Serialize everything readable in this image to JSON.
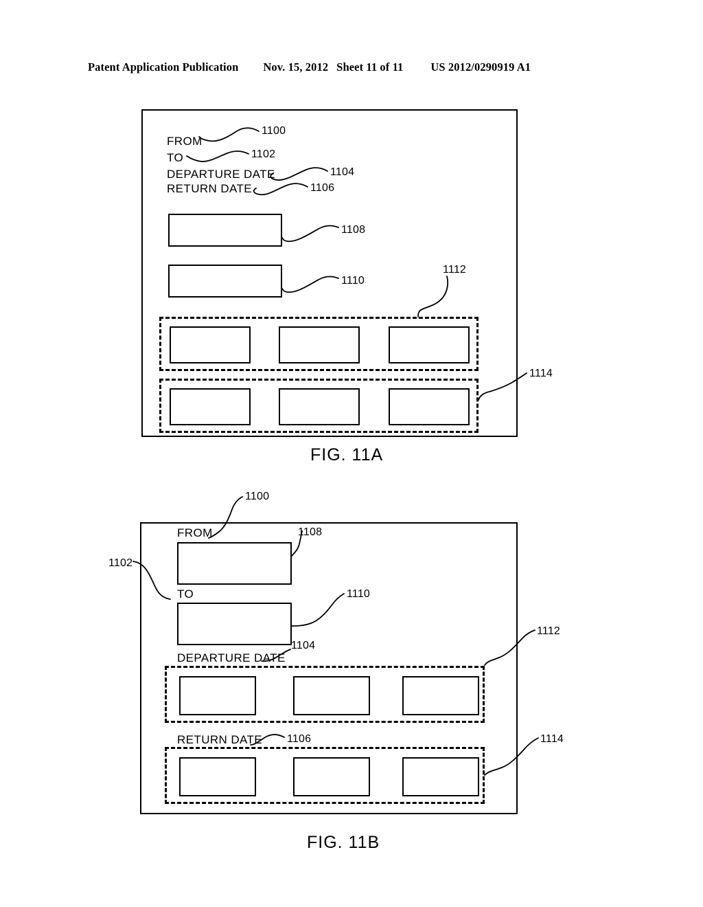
{
  "header": {
    "publication": "Patent Application Publication",
    "date": "Nov. 15, 2012",
    "sheet": "Sheet 11 of 11",
    "doc_number": "US 2012/0290919 A1"
  },
  "colors": {
    "ink": "#000000",
    "paper": "#ffffff"
  },
  "figures": [
    {
      "id": "fig-11a",
      "caption": "FIG. 11A",
      "labels": {
        "from": "FROM",
        "to": "TO",
        "departure_date": "DEPARTURE DATE",
        "return_date": "RETURN DATE"
      },
      "refs": {
        "screen": "1100",
        "to_field": "1102",
        "departure_field": "1104",
        "return_field": "1106",
        "from_input": "1108",
        "to_input": "1110",
        "departure_group": "1112",
        "return_group": "1114"
      }
    },
    {
      "id": "fig-11b",
      "caption": "FIG. 11B",
      "labels": {
        "from": "FROM",
        "to": "TO",
        "departure_date": "DEPARTURE DATE",
        "return_date": "RETURN DATE"
      },
      "refs": {
        "screen": "1100",
        "to_field": "1102",
        "departure_field": "1104",
        "return_field": "1106",
        "from_input": "1108",
        "to_input": "1110",
        "departure_group": "1112",
        "return_group": "1114"
      }
    }
  ]
}
